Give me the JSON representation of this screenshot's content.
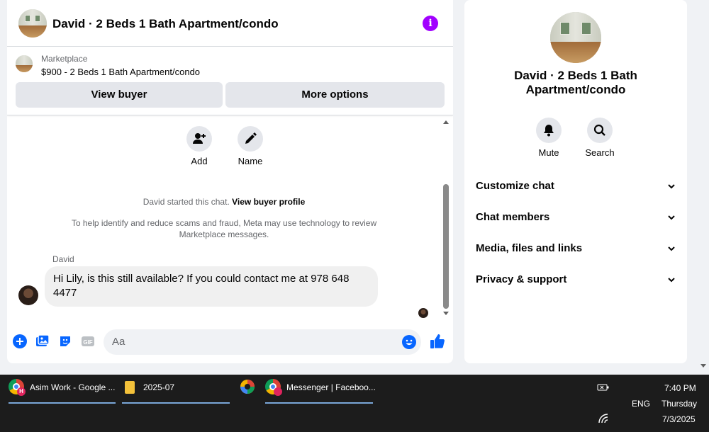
{
  "chat": {
    "header_title": "David · 2 Beds 1 Bath Apartment/condo",
    "marketplace_label": "Marketplace",
    "listing": "$900 - 2 Beds 1 Bath Apartment/condo",
    "view_buyer": "View buyer",
    "more_options": "More options",
    "actions": {
      "add": "Add",
      "name": "Name"
    },
    "started_prefix": "David started this chat.",
    "started_link": "View buyer profile",
    "notice": "To help identify and reduce scams and fraud, Meta may use technology to review Marketplace messages.",
    "sender": "David",
    "message": "Hi Lily, is this still available? If you could contact me at 978 648 4477",
    "input_placeholder": "Aa",
    "gif_label": "GIF"
  },
  "info": {
    "name": "David · 2 Beds 1 Bath Apartment/condo",
    "mute": "Mute",
    "search": "Search",
    "sections": [
      "Customize chat",
      "Chat members",
      "Media, files and links",
      "Privacy & support"
    ]
  },
  "taskbar": {
    "items": [
      {
        "label": "Asim Work - Google ...",
        "badge": "H"
      },
      {
        "label": "2025-07"
      },
      {
        "label": "Messenger | Faceboo..."
      }
    ],
    "lang": "ENG",
    "time": "7:40 PM",
    "day": "Thursday",
    "date": "7/3/2025"
  },
  "colors": {
    "accent": "#0866ff",
    "info_purple": "#a100ff"
  }
}
